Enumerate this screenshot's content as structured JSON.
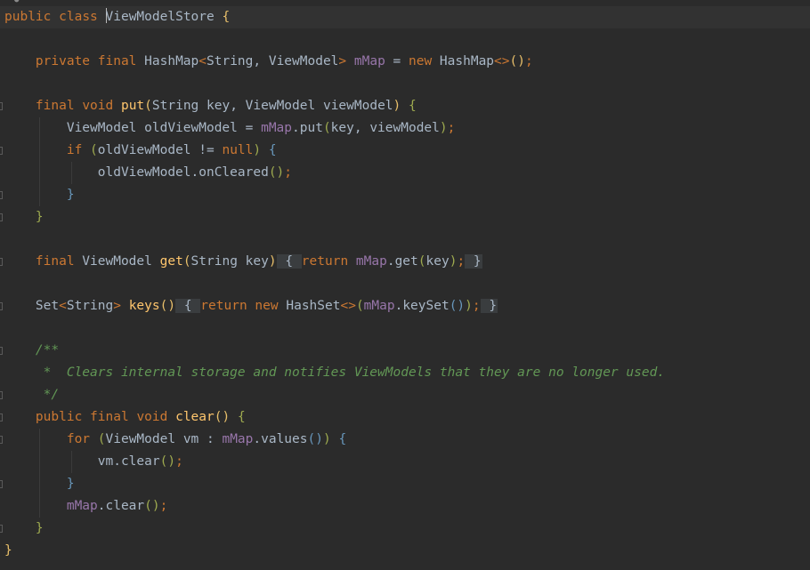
{
  "editor": {
    "language": "java",
    "lines": [
      [
        [
          "kw",
          "public"
        ],
        [
          "tx",
          " "
        ],
        [
          "kw",
          "class"
        ],
        [
          "tx",
          " "
        ],
        [
          "cursor",
          ""
        ],
        [
          "tx",
          "ViewModelStore"
        ],
        [
          "tx",
          " "
        ],
        [
          "b1",
          "{"
        ]
      ],
      [],
      [
        [
          "tx",
          "    "
        ],
        [
          "kw",
          "private"
        ],
        [
          "tx",
          " "
        ],
        [
          "kw",
          "final"
        ],
        [
          "tx",
          " HashMap"
        ],
        [
          "pg",
          "<"
        ],
        [
          "tx",
          "String, ViewModel"
        ],
        [
          "pg",
          ">"
        ],
        [
          "tx",
          " "
        ],
        [
          "fd",
          "mMap"
        ],
        [
          "tx",
          " = "
        ],
        [
          "kw",
          "new"
        ],
        [
          "tx",
          " HashMap"
        ],
        [
          "pg",
          "<>"
        ],
        [
          "b1",
          "()"
        ],
        [
          "pg",
          ";"
        ]
      ],
      [],
      [
        [
          "tx",
          "    "
        ],
        [
          "kw",
          "final"
        ],
        [
          "tx",
          " "
        ],
        [
          "kw",
          "void"
        ],
        [
          "tx",
          " "
        ],
        [
          "fn",
          "put"
        ],
        [
          "b1",
          "("
        ],
        [
          "tx",
          "String key, ViewModel viewModel"
        ],
        [
          "b1",
          ")"
        ],
        [
          "tx",
          " "
        ],
        [
          "b3",
          "{"
        ]
      ],
      [
        [
          "tx",
          "        ViewModel oldViewModel = "
        ],
        [
          "fd",
          "mMap"
        ],
        [
          "tx",
          ".put"
        ],
        [
          "b3",
          "("
        ],
        [
          "tx",
          "key, viewModel"
        ],
        [
          "b3",
          ")"
        ],
        [
          "pg",
          ";"
        ]
      ],
      [
        [
          "tx",
          "        "
        ],
        [
          "kw",
          "if"
        ],
        [
          "tx",
          " "
        ],
        [
          "b3",
          "("
        ],
        [
          "tx",
          "oldViewModel != "
        ],
        [
          "kw",
          "null"
        ],
        [
          "b3",
          ")"
        ],
        [
          "tx",
          " "
        ],
        [
          "b2",
          "{"
        ]
      ],
      [
        [
          "tx",
          "            oldViewModel.onCleared"
        ],
        [
          "b3",
          "()"
        ],
        [
          "pg",
          ";"
        ]
      ],
      [
        [
          "tx",
          "        "
        ],
        [
          "b2",
          "}"
        ]
      ],
      [
        [
          "tx",
          "    "
        ],
        [
          "b3",
          "}"
        ]
      ],
      [],
      [
        [
          "tx",
          "    "
        ],
        [
          "kw",
          "final"
        ],
        [
          "tx",
          " ViewModel "
        ],
        [
          "fn",
          "get"
        ],
        [
          "b1",
          "("
        ],
        [
          "tx",
          "String key"
        ],
        [
          "b1",
          ")"
        ],
        [
          "fold",
          " { "
        ],
        [
          "kw",
          "return"
        ],
        [
          "tx",
          " "
        ],
        [
          "fd",
          "mMap"
        ],
        [
          "tx",
          ".get"
        ],
        [
          "b3",
          "("
        ],
        [
          "tx",
          "key"
        ],
        [
          "b3",
          ")"
        ],
        [
          "pg",
          ";"
        ],
        [
          "fold",
          " }"
        ]
      ],
      [],
      [
        [
          "tx",
          "    Set"
        ],
        [
          "pg",
          "<"
        ],
        [
          "tx",
          "String"
        ],
        [
          "pg",
          ">"
        ],
        [
          "tx",
          " "
        ],
        [
          "fn",
          "keys"
        ],
        [
          "b1",
          "()"
        ],
        [
          "fold",
          " { "
        ],
        [
          "kw",
          "return"
        ],
        [
          "tx",
          " "
        ],
        [
          "kw",
          "new"
        ],
        [
          "tx",
          " HashSet"
        ],
        [
          "pg",
          "<>"
        ],
        [
          "b3",
          "("
        ],
        [
          "fd",
          "mMap"
        ],
        [
          "tx",
          ".keySet"
        ],
        [
          "b2",
          "()"
        ],
        [
          "b3",
          ")"
        ],
        [
          "pg",
          ";"
        ],
        [
          "fold",
          " }"
        ]
      ],
      [],
      [
        [
          "tx",
          "    "
        ],
        [
          "cm",
          "/**"
        ]
      ],
      [
        [
          "tx",
          "    "
        ],
        [
          "cm",
          " *  Clears internal storage and notifies ViewModels that they are no longer used."
        ]
      ],
      [
        [
          "tx",
          "    "
        ],
        [
          "cm",
          " */"
        ]
      ],
      [
        [
          "tx",
          "    "
        ],
        [
          "kw",
          "public"
        ],
        [
          "tx",
          " "
        ],
        [
          "kw",
          "final"
        ],
        [
          "tx",
          " "
        ],
        [
          "kw",
          "void"
        ],
        [
          "tx",
          " "
        ],
        [
          "fn",
          "clear"
        ],
        [
          "b1",
          "()"
        ],
        [
          "tx",
          " "
        ],
        [
          "b3",
          "{"
        ]
      ],
      [
        [
          "tx",
          "        "
        ],
        [
          "kw",
          "for"
        ],
        [
          "tx",
          " "
        ],
        [
          "b3",
          "("
        ],
        [
          "tx",
          "ViewModel vm : "
        ],
        [
          "fd",
          "mMap"
        ],
        [
          "tx",
          ".values"
        ],
        [
          "b2",
          "()"
        ],
        [
          "b3",
          ")"
        ],
        [
          "tx",
          " "
        ],
        [
          "b2",
          "{"
        ]
      ],
      [
        [
          "tx",
          "            vm.clear"
        ],
        [
          "b3",
          "()"
        ],
        [
          "pg",
          ";"
        ]
      ],
      [
        [
          "tx",
          "        "
        ],
        [
          "b2",
          "}"
        ]
      ],
      [
        [
          "tx",
          "        "
        ],
        [
          "fd",
          "mMap"
        ],
        [
          "tx",
          ".clear"
        ],
        [
          "b3",
          "()"
        ],
        [
          "pg",
          ";"
        ]
      ],
      [
        [
          "tx",
          "    "
        ],
        [
          "b3",
          "}"
        ]
      ],
      [
        [
          "b1",
          "}"
        ]
      ]
    ]
  }
}
